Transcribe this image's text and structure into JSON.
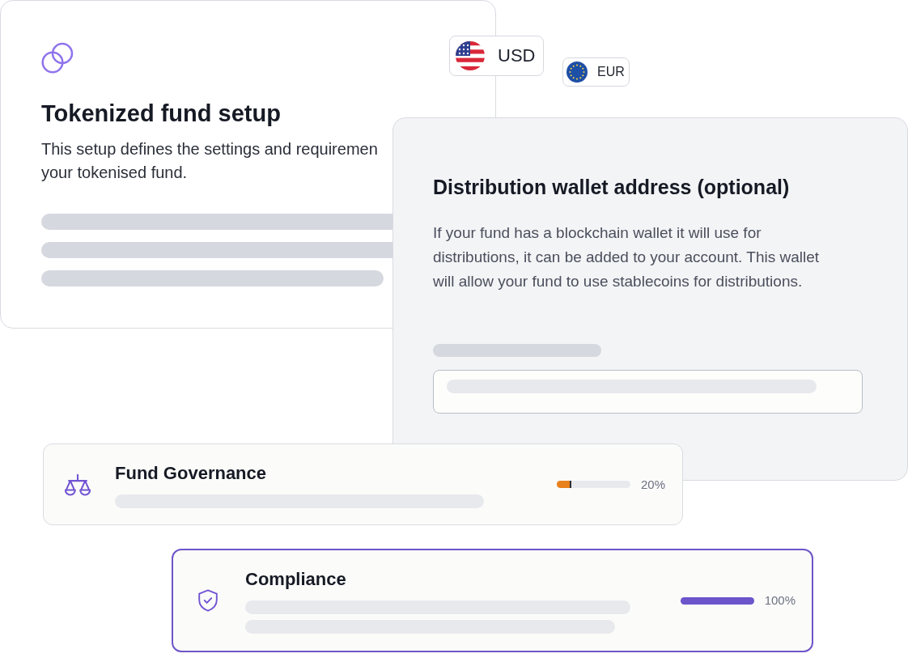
{
  "setup_card": {
    "title": "Tokenized fund setup",
    "description": "This setup defines the settings and requiremen\nyour tokenised fund."
  },
  "currencies": [
    {
      "code": "USD",
      "kind": "us"
    },
    {
      "code": "EUR",
      "kind": "eu"
    }
  ],
  "wallet_card": {
    "title": "Distribution wallet address (optional)",
    "description": "If your fund has a blockchain wallet it will use for distributions, it can be added to your account. This wallet will allow your fund to use stablecoins for distributions."
  },
  "sections": [
    {
      "title": "Fund Governance",
      "kind": "governance",
      "selected": false,
      "level": 0.2,
      "reading": "20%",
      "color": "#e8801c"
    },
    {
      "title": "Compliance",
      "kind": "compliance",
      "selected": true,
      "level": 1,
      "reading": "100%",
      "color": "#6c54cb"
    }
  ]
}
